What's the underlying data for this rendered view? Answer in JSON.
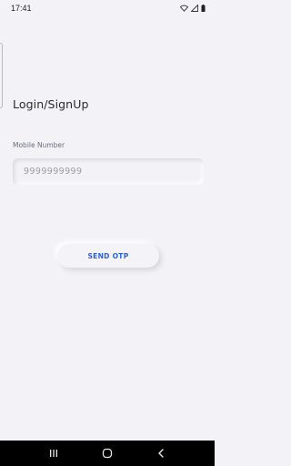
{
  "status_bar": {
    "time": "17:41",
    "icons": [
      "wifi-icon",
      "signal-icon",
      "battery-icon"
    ]
  },
  "login": {
    "title": "Login/SignUp",
    "mobile_label": "Mobile Number",
    "mobile_value": "",
    "mobile_placeholder": "9999999999",
    "send_otp_label": "SEND OTP"
  },
  "nav_bar": {
    "buttons": [
      "recent-apps-icon",
      "home-icon",
      "back-icon"
    ]
  },
  "colors": {
    "background": "#f2f2f7",
    "accent": "#2f5fd4",
    "nav_bar": "#000000"
  }
}
